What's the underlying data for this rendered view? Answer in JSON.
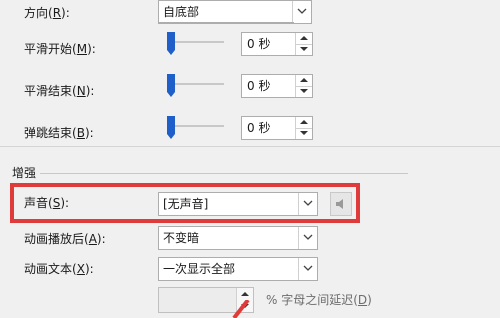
{
  "effect": {
    "direction": {
      "label": "方向",
      "key": "R",
      "value": "自底部"
    },
    "smooth_start": {
      "label": "平滑开始",
      "key": "M",
      "value": "0 秒"
    },
    "smooth_end": {
      "label": "平滑结束",
      "key": "N",
      "value": "0 秒"
    },
    "bounce_end": {
      "label": "弹跳结束",
      "key": "B",
      "value": "0 秒"
    }
  },
  "enhance": {
    "section_title": "增强",
    "sound": {
      "label": "声音",
      "key": "S",
      "value": "[无声音]"
    },
    "after_animation": {
      "label": "动画播放后",
      "key": "A",
      "value": "不变暗"
    },
    "animate_text": {
      "label": "动画文本",
      "key": "X",
      "value": "一次显示全部"
    },
    "delay": {
      "value": "",
      "suffix": "% 字母之间延迟",
      "key": "D"
    }
  },
  "colors": {
    "highlight": "#e03b3b",
    "thumb": "#1f5fc9"
  }
}
